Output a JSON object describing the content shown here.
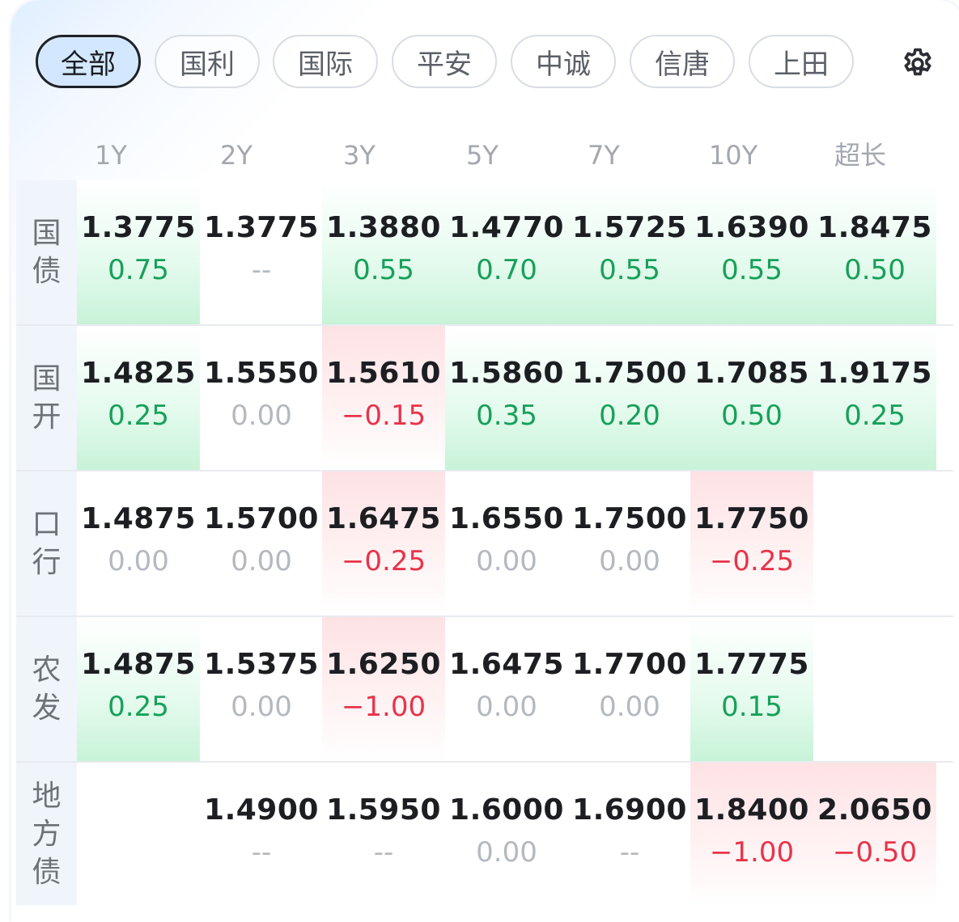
{
  "tabs": [
    {
      "label": "全部",
      "active": true
    },
    {
      "label": "国利",
      "active": false
    },
    {
      "label": "国际",
      "active": false
    },
    {
      "label": "平安",
      "active": false
    },
    {
      "label": "中诚",
      "active": false
    },
    {
      "label": "信唐",
      "active": false
    },
    {
      "label": "上田",
      "active": false
    }
  ],
  "settings_icon": "gear-icon",
  "columns": [
    "1Y",
    "2Y",
    "3Y",
    "5Y",
    "7Y",
    "10Y",
    "超长"
  ],
  "rows": [
    {
      "label": "国债",
      "cells": [
        {
          "rate": "1.3775",
          "change": "0.75",
          "trend": "up"
        },
        {
          "rate": "1.3775",
          "change": "--",
          "trend": "none"
        },
        {
          "rate": "1.3880",
          "change": "0.55",
          "trend": "up"
        },
        {
          "rate": "1.4770",
          "change": "0.70",
          "trend": "up"
        },
        {
          "rate": "1.5725",
          "change": "0.55",
          "trend": "up"
        },
        {
          "rate": "1.6390",
          "change": "0.55",
          "trend": "up"
        },
        {
          "rate": "1.8475",
          "change": "0.50",
          "trend": "up"
        }
      ]
    },
    {
      "label": "国开",
      "cells": [
        {
          "rate": "1.4825",
          "change": "0.25",
          "trend": "up"
        },
        {
          "rate": "1.5550",
          "change": "0.00",
          "trend": "flat"
        },
        {
          "rate": "1.5610",
          "change": "−0.15",
          "trend": "down"
        },
        {
          "rate": "1.5860",
          "change": "0.35",
          "trend": "up"
        },
        {
          "rate": "1.7500",
          "change": "0.20",
          "trend": "up"
        },
        {
          "rate": "1.7085",
          "change": "0.50",
          "trend": "up"
        },
        {
          "rate": "1.9175",
          "change": "0.25",
          "trend": "up"
        }
      ]
    },
    {
      "label": "口行",
      "cells": [
        {
          "rate": "1.4875",
          "change": "0.00",
          "trend": "flat"
        },
        {
          "rate": "1.5700",
          "change": "0.00",
          "trend": "flat"
        },
        {
          "rate": "1.6475",
          "change": "−0.25",
          "trend": "down"
        },
        {
          "rate": "1.6550",
          "change": "0.00",
          "trend": "flat"
        },
        {
          "rate": "1.7500",
          "change": "0.00",
          "trend": "flat"
        },
        {
          "rate": "1.7750",
          "change": "−0.25",
          "trend": "down"
        },
        {
          "rate": "",
          "change": "",
          "trend": "empty"
        }
      ]
    },
    {
      "label": "农发",
      "cells": [
        {
          "rate": "1.4875",
          "change": "0.25",
          "trend": "up"
        },
        {
          "rate": "1.5375",
          "change": "0.00",
          "trend": "flat"
        },
        {
          "rate": "1.6250",
          "change": "−1.00",
          "trend": "down"
        },
        {
          "rate": "1.6475",
          "change": "0.00",
          "trend": "flat"
        },
        {
          "rate": "1.7700",
          "change": "0.00",
          "trend": "flat"
        },
        {
          "rate": "1.7775",
          "change": "0.15",
          "trend": "up"
        },
        {
          "rate": "",
          "change": "",
          "trend": "empty"
        }
      ]
    },
    {
      "label": "地方债",
      "cells": [
        {
          "rate": "",
          "change": "",
          "trend": "empty"
        },
        {
          "rate": "1.4900",
          "change": "--",
          "trend": "none"
        },
        {
          "rate": "1.5950",
          "change": "--",
          "trend": "none"
        },
        {
          "rate": "1.6000",
          "change": "0.00",
          "trend": "flat"
        },
        {
          "rate": "1.6900",
          "change": "--",
          "trend": "none"
        },
        {
          "rate": "1.8400",
          "change": "−1.00",
          "trend": "down"
        },
        {
          "rate": "2.0650",
          "change": "−0.50",
          "trend": "down"
        }
      ]
    }
  ]
}
